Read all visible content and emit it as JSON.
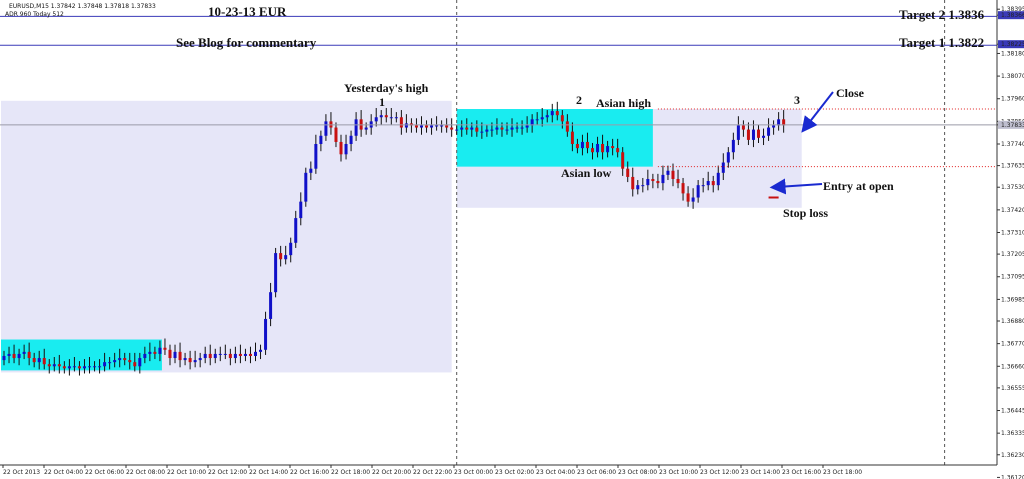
{
  "header": {
    "symbol_info": "EURUSD,M15  1.37842 1.37848 1.37818 1.37833",
    "adr_info": "ADR 960  Today 512"
  },
  "annotations": {
    "date_title": "10-23-13  EUR",
    "blog_note": "See Blog for commentary",
    "target2_label": "Target 2  1.3836",
    "target1_label": "Target 1  1.3822",
    "yesterdays_high": "Yesterday's high",
    "point1": "1",
    "point2": "2",
    "point3": "3",
    "asian_high": "Asian high",
    "asian_low": "Asian low",
    "close": "Close",
    "entry": "Entry at open",
    "stop_loss": "Stop loss"
  },
  "colors": {
    "bull": "#1010c8",
    "bear": "#c81010",
    "range_box": "#e6e6f8",
    "asian_box": "#19ecf0",
    "target_line": "#3a3ab8",
    "red_dotted": "#e02020",
    "arrow": "#1a2ad0",
    "current_price_line": "#9a9aa8"
  },
  "chart_data": {
    "type": "candlestick",
    "symbol": "EURUSD",
    "timeframe": "M15",
    "ylim": [
      1.3619,
      1.3843
    ],
    "y_ticks": [
      1.38395,
      1.38366,
      1.38225,
      1.3818,
      1.3807,
      1.3796,
      1.3785,
      1.37833,
      1.3774,
      1.37635,
      1.3753,
      1.3742,
      1.3731,
      1.37205,
      1.37095,
      1.36985,
      1.3688,
      1.3677,
      1.3666,
      1.36555,
      1.36445,
      1.36335,
      1.3623,
      1.3612
    ],
    "y_tick_labels": [
      "1.38395",
      "1.38366",
      "1.38225",
      "1.38180",
      "1.38070",
      "1.37960",
      "1.37850",
      "1.37833",
      "1.37740",
      "1.37635",
      "1.37530",
      "1.37420",
      "1.37310",
      "1.37205",
      "1.37095",
      "1.36985",
      "1.36880",
      "1.36770",
      "1.36660",
      "1.36555",
      "1.36445",
      "1.36335",
      "1.36230",
      "1.36120"
    ],
    "x_tick_labels": [
      "22 Oct 2013",
      "22 Oct 04:00",
      "22 Oct 06:00",
      "22 Oct 08:00",
      "22 Oct 10:00",
      "22 Oct 12:00",
      "22 Oct 14:00",
      "22 Oct 16:00",
      "22 Oct 18:00",
      "22 Oct 20:00",
      "22 Oct 22:00",
      "23 Oct 00:00",
      "23 Oct 02:00",
      "23 Oct 04:00",
      "23 Oct 06:00",
      "23 Oct 08:00",
      "23 Oct 10:00",
      "23 Oct 12:00",
      "23 Oct 14:00",
      "23 Oct 16:00",
      "23 Oct 18:00"
    ],
    "levels": {
      "target2": 1.3836,
      "target1": 1.3822,
      "current_price": 1.37833,
      "asian_high": 1.3791,
      "asian_low": 1.3763,
      "stop_loss": 1.3748
    },
    "candles_start_index": 0,
    "closes": [
      1.3671,
      1.3672,
      1.367,
      1.3672,
      1.3673,
      1.367,
      1.3668,
      1.367,
      1.3667,
      1.3666,
      1.3667,
      1.3666,
      1.3665,
      1.3666,
      1.3666,
      1.3665,
      1.3666,
      1.3666,
      1.3666,
      1.3666,
      1.3668,
      1.3668,
      1.3669,
      1.367,
      1.3669,
      1.3668,
      1.3666,
      1.367,
      1.3672,
      1.3673,
      1.3672,
      1.3675,
      1.3674,
      1.367,
      1.3673,
      1.3669,
      1.367,
      1.3668,
      1.3669,
      1.367,
      1.3672,
      1.367,
      1.3672,
      1.3672,
      1.3672,
      1.367,
      1.3672,
      1.3671,
      1.3672,
      1.3671,
      1.3673,
      1.3674,
      1.3689,
      1.3702,
      1.3721,
      1.3718,
      1.372,
      1.3726,
      1.3738,
      1.3746,
      1.376,
      1.3762,
      1.3774,
      1.3778,
      1.3785,
      1.3782,
      1.3775,
      1.3769,
      1.3774,
      1.3778,
      1.3786,
      1.3781,
      1.3782,
      1.3785,
      1.3787,
      1.3788,
      1.3787,
      1.3787,
      1.3787,
      1.3782,
      1.3784,
      1.3783,
      1.3782,
      1.3783,
      1.3782,
      1.3783,
      1.3783,
      1.3783,
      1.3782,
      1.3781,
      1.3781,
      1.3782,
      1.3781,
      1.3782,
      1.378,
      1.378,
      1.3781,
      1.3781,
      1.3782,
      1.3781,
      1.3781,
      1.3782,
      1.3782,
      1.3782,
      1.3783,
      1.3786,
      1.3786,
      1.3787,
      1.3788,
      1.379,
      1.3788,
      1.3785,
      1.378,
      1.3774,
      1.3772,
      1.3775,
      1.3772,
      1.377,
      1.3774,
      1.377,
      1.3773,
      1.3772,
      1.377,
      1.3762,
      1.3758,
      1.3752,
      1.3754,
      1.3754,
      1.3757,
      1.3756,
      1.3755,
      1.3759,
      1.3761,
      1.3757,
      1.3755,
      1.375,
      1.3746,
      1.3748,
      1.3754,
      1.3754,
      1.3756,
      1.3754,
      1.376,
      1.3765,
      1.377,
      1.3776,
      1.3783,
      1.3781,
      1.3776,
      1.3781,
      1.3777,
      1.3778,
      1.3782,
      1.3783,
      1.3786,
      1.3783
    ]
  }
}
